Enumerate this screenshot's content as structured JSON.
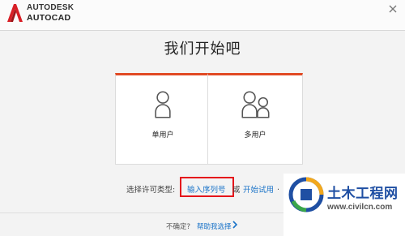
{
  "header": {
    "brand": "AUTODESK",
    "product": "AUTOCAD",
    "logo_icon": "autocad-a-logo",
    "close_icon": "close-icon",
    "accent_color": "#e14a24"
  },
  "title": "我们开始吧",
  "cards": [
    {
      "label": "单用户",
      "icon": "single-user-icon"
    },
    {
      "label": "多用户",
      "icon": "multi-user-icon"
    }
  ],
  "license": {
    "prefix": "选择许可类型:",
    "serial_link": "输入序列号",
    "or": "或",
    "trial_link": "开始试用",
    "period": ".",
    "highlight_color": "#e5151b"
  },
  "footer": {
    "question": "不确定?",
    "help_link": "帮助我选择",
    "chevron_icon": "chevron-right-icon"
  },
  "watermark": {
    "title": "土木工程网",
    "url": "www.civilcn.com"
  }
}
